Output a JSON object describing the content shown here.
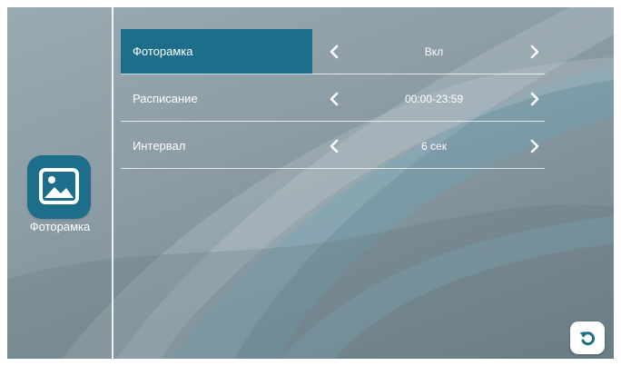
{
  "sidebar": {
    "app_label": "Фоторамка",
    "app_icon": "picture-icon",
    "accent_color": "#1d6e8a"
  },
  "settings": [
    {
      "label": "Фоторамка",
      "value": "Вкл",
      "selected": true
    },
    {
      "label": "Расписание",
      "value": "00:00-23:59",
      "selected": false
    },
    {
      "label": "Интервал",
      "value": "6 сек",
      "selected": false
    }
  ],
  "icons": {
    "left_arrow": "chevron-left-icon",
    "right_arrow": "chevron-right-icon",
    "back": "back-icon"
  }
}
